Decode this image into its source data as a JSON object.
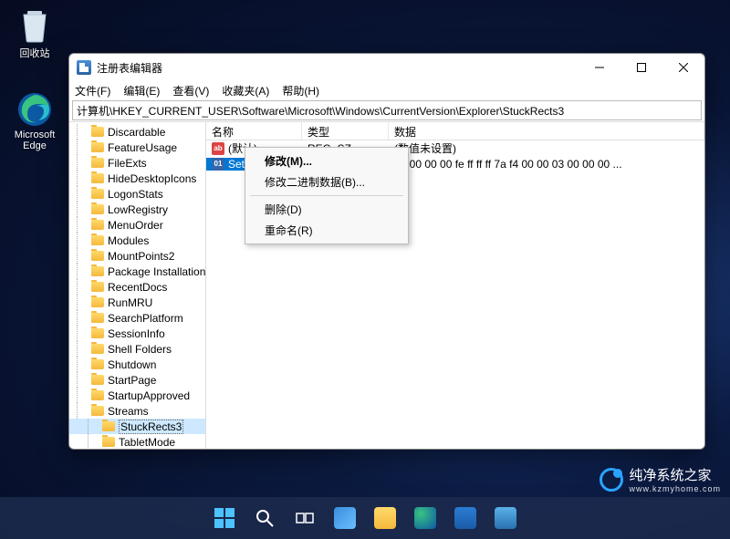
{
  "desktop": {
    "recycle_bin": "回收站",
    "edge": "Microsoft Edge"
  },
  "window": {
    "title": "注册表编辑器",
    "menus": [
      "文件(F)",
      "编辑(E)",
      "查看(V)",
      "收藏夹(A)",
      "帮助(H)"
    ],
    "address": "计算机\\HKEY_CURRENT_USER\\Software\\Microsoft\\Windows\\CurrentVersion\\Explorer\\StuckRects3"
  },
  "tree": {
    "items": [
      {
        "label": "Discardable",
        "depth": 1
      },
      {
        "label": "FeatureUsage",
        "depth": 1
      },
      {
        "label": "FileExts",
        "depth": 1
      },
      {
        "label": "HideDesktopIcons",
        "depth": 1
      },
      {
        "label": "LogonStats",
        "depth": 1
      },
      {
        "label": "LowRegistry",
        "depth": 1
      },
      {
        "label": "MenuOrder",
        "depth": 1
      },
      {
        "label": "Modules",
        "depth": 1
      },
      {
        "label": "MountPoints2",
        "depth": 1
      },
      {
        "label": "Package Installation",
        "depth": 1
      },
      {
        "label": "RecentDocs",
        "depth": 1
      },
      {
        "label": "RunMRU",
        "depth": 1
      },
      {
        "label": "SearchPlatform",
        "depth": 1
      },
      {
        "label": "SessionInfo",
        "depth": 1
      },
      {
        "label": "Shell Folders",
        "depth": 1
      },
      {
        "label": "Shutdown",
        "depth": 1
      },
      {
        "label": "StartPage",
        "depth": 1
      },
      {
        "label": "StartupApproved",
        "depth": 1
      },
      {
        "label": "Streams",
        "depth": 1
      },
      {
        "label": "StuckRects3",
        "depth": 2,
        "selected": true
      },
      {
        "label": "TabletMode",
        "depth": 2
      }
    ]
  },
  "list": {
    "headers": {
      "name": "名称",
      "type": "类型",
      "data": "数据"
    },
    "rows": [
      {
        "name": "(默认)",
        "type": "REG_SZ",
        "data": "(数值未设置)",
        "ico": "sz"
      },
      {
        "name": "Settings",
        "type": "",
        "data": "30 00 00 00 fe ff ff ff 7a f4 00 00 03 00 00 00 ...",
        "ico": "bin",
        "selected": true
      }
    ]
  },
  "context_menu": {
    "items": [
      {
        "label": "修改(M)...",
        "bold": true
      },
      {
        "label": "修改二进制数据(B)..."
      },
      {
        "sep": true
      },
      {
        "label": "删除(D)"
      },
      {
        "label": "重命名(R)"
      }
    ]
  },
  "watermark": {
    "text": "纯净系统之家",
    "url": "www.kzmyhome.com"
  }
}
